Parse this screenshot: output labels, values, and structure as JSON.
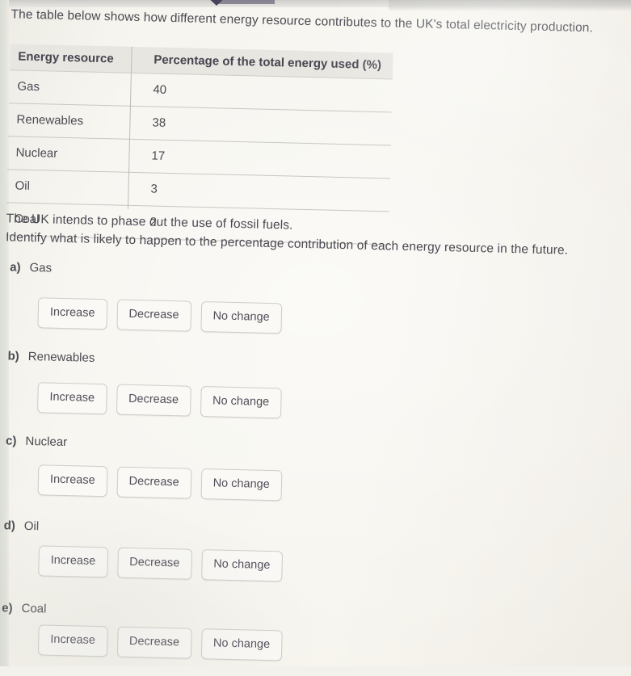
{
  "intro": "The table below shows how different energy resource contributes to the UK's total electricity production.",
  "table": {
    "headers": [
      "Energy resource",
      "Percentage of the total energy used (%)"
    ],
    "rows": [
      [
        "Gas",
        "40"
      ],
      [
        "Renewables",
        "38"
      ],
      [
        "Nuclear",
        "17"
      ],
      [
        "Oil",
        "3"
      ],
      [
        "Coal",
        "2"
      ]
    ]
  },
  "question": {
    "line1": "The UK intends to phase out the use of fossil fuels.",
    "line2": "Identify what is likely to happen to the percentage contribution of each energy resource in the future."
  },
  "options": {
    "increase": "Increase",
    "decrease": "Decrease",
    "no_change": "No change"
  },
  "parts": [
    {
      "marker": "a)",
      "label": "Gas"
    },
    {
      "marker": "b)",
      "label": "Renewables"
    },
    {
      "marker": "c)",
      "label": "Nuclear"
    },
    {
      "marker": "d)",
      "label": "Oil"
    },
    {
      "marker": "e)",
      "label": "Coal"
    }
  ],
  "colors": {
    "page_background": "#f4f1ea",
    "text": "#4b4a52",
    "table_header_background": "#e7e6e1",
    "table_rule": "#c8c7c2",
    "button_background": "#faf9f6",
    "button_border": "#cfcdc7",
    "gutter": "#d9dcd5",
    "top_marker": "#3a3550"
  }
}
